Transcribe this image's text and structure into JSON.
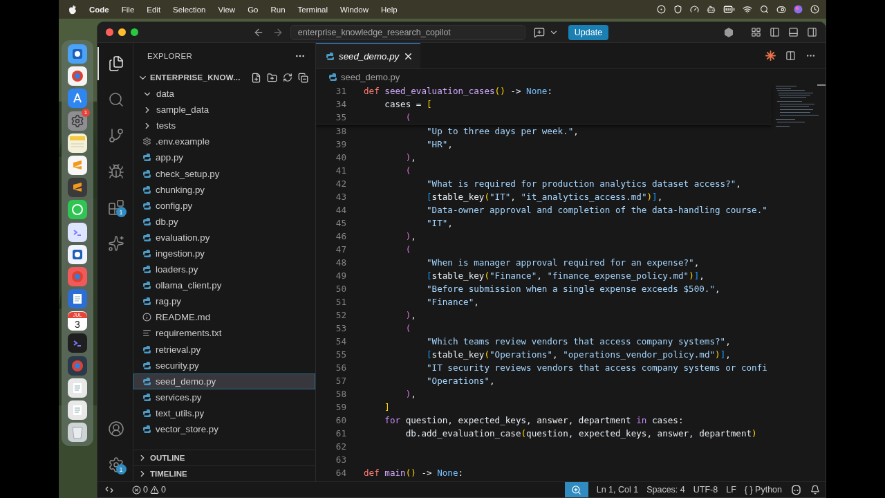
{
  "menu_bar": {
    "app": "Code",
    "items": [
      "File",
      "Edit",
      "Selection",
      "View",
      "Go",
      "Run",
      "Terminal",
      "Window",
      "Help"
    ]
  },
  "dock": {
    "items": [
      {
        "kind": "face",
        "color": "#4aa3f5"
      },
      {
        "kind": "ring",
        "color": "#f4f4f4"
      },
      {
        "kind": "letter",
        "color": "#2f86f0"
      },
      {
        "kind": "gear",
        "color": "#8e8e93",
        "badge": "1"
      },
      {
        "kind": "note",
        "color": "#f5f0d8"
      },
      {
        "kind": "ribbon",
        "color": "#f7f7f7"
      },
      {
        "kind": "ribbon",
        "color": "#3a3a3a"
      },
      {
        "kind": "bubble",
        "color": "#2fc553"
      },
      {
        "kind": "prompt",
        "color": "#dfe4ff"
      },
      {
        "kind": "face",
        "color": "#f2f4ff"
      },
      {
        "kind": "ring",
        "color": "#f05a5a"
      },
      {
        "kind": "doc",
        "color": "#2b6fd6"
      },
      {
        "kind": "calendar",
        "color": "#ffffff",
        "month": "JUL",
        "day": "3"
      },
      {
        "kind": "prompt",
        "color": "#1f1f1f"
      },
      {
        "kind": "ring",
        "color": "#2a3a4a"
      },
      {
        "kind": "doc",
        "color": "#e8e8e8"
      },
      {
        "kind": "doc",
        "color": "#e8e8e8"
      },
      {
        "kind": "bin",
        "color": "#cfd3d6"
      }
    ]
  },
  "window": {
    "title": "enterprise_knowledge_research_copilot",
    "update_button": "Update"
  },
  "activity_bar": {
    "items": [
      {
        "kind": "files",
        "selected": true
      },
      {
        "kind": "search",
        "selected": false
      },
      {
        "kind": "branch",
        "selected": false
      },
      {
        "kind": "debug",
        "selected": false
      },
      {
        "kind": "extensions",
        "selected": false,
        "badge": "1"
      },
      {
        "kind": "spark",
        "selected": false
      }
    ],
    "bottom": [
      {
        "kind": "account"
      },
      {
        "kind": "settings",
        "badge": "1"
      }
    ]
  },
  "sidebar": {
    "title": "EXPLORER",
    "root": {
      "label": "ENTERPRISE_KNOW...",
      "expanded": true
    },
    "items": [
      {
        "kind": "folder",
        "label": "data",
        "expanded": true,
        "selected": false
      },
      {
        "kind": "folder",
        "label": "sample_data",
        "expanded": false,
        "selected": false
      },
      {
        "kind": "folder",
        "label": "tests",
        "expanded": false,
        "selected": false
      },
      {
        "kind": "config",
        "label": ".env.example",
        "selected": false
      },
      {
        "kind": "python",
        "label": "app.py",
        "selected": false
      },
      {
        "kind": "python",
        "label": "check_setup.py",
        "selected": false
      },
      {
        "kind": "python",
        "label": "chunking.py",
        "selected": false
      },
      {
        "kind": "python",
        "label": "config.py",
        "selected": false
      },
      {
        "kind": "python",
        "label": "db.py",
        "selected": false
      },
      {
        "kind": "python",
        "label": "evaluation.py",
        "selected": false
      },
      {
        "kind": "python",
        "label": "ingestion.py",
        "selected": false
      },
      {
        "kind": "python",
        "label": "loaders.py",
        "selected": false
      },
      {
        "kind": "python",
        "label": "ollama_client.py",
        "selected": false
      },
      {
        "kind": "python",
        "label": "rag.py",
        "selected": false
      },
      {
        "kind": "info",
        "label": "README.md",
        "selected": false
      },
      {
        "kind": "text",
        "label": "requirements.txt",
        "selected": false
      },
      {
        "kind": "python",
        "label": "retrieval.py",
        "selected": false
      },
      {
        "kind": "python",
        "label": "security.py",
        "selected": false
      },
      {
        "kind": "python",
        "label": "seed_demo.py",
        "selected": true
      },
      {
        "kind": "python",
        "label": "services.py",
        "selected": false
      },
      {
        "kind": "python",
        "label": "text_utils.py",
        "selected": false
      },
      {
        "kind": "python",
        "label": "vector_store.py",
        "selected": false
      }
    ],
    "sections": [
      {
        "label": "OUTLINE",
        "expanded": false
      },
      {
        "label": "TIMELINE",
        "expanded": false
      }
    ]
  },
  "editor": {
    "tabs": [
      {
        "label": "seed_demo.py",
        "selected": true,
        "preview": true
      }
    ],
    "breadcrumb": "seed_demo.py",
    "sticky_lines": [
      {
        "number": "31",
        "tokens": [
          {
            "kind": "def",
            "text": "def "
          },
          {
            "kind": "func",
            "text": "seed_evaluation_cases"
          },
          {
            "kind": "b1",
            "text": "()"
          },
          {
            "kind": "text",
            "text": " -> "
          },
          {
            "kind": "const",
            "text": "None"
          },
          {
            "kind": "text",
            "text": ":"
          }
        ]
      },
      {
        "number": "34",
        "tokens": [
          {
            "kind": "text",
            "text": "    cases = "
          },
          {
            "kind": "b1",
            "text": "["
          }
        ]
      },
      {
        "number": "35",
        "tokens": [
          {
            "kind": "b2",
            "text": "        ("
          }
        ]
      }
    ],
    "lines": [
      {
        "number": "38",
        "tokens": [
          {
            "kind": "str",
            "text": "            \"Up to three days per week.\""
          },
          {
            "kind": "text",
            "text": ","
          }
        ]
      },
      {
        "number": "39",
        "tokens": [
          {
            "kind": "str",
            "text": "            \"HR\""
          },
          {
            "kind": "text",
            "text": ","
          }
        ]
      },
      {
        "number": "40",
        "tokens": [
          {
            "kind": "b2",
            "text": "        )"
          },
          {
            "kind": "text",
            "text": ","
          }
        ]
      },
      {
        "number": "41",
        "tokens": [
          {
            "kind": "b2",
            "text": "        ("
          }
        ]
      },
      {
        "number": "42",
        "tokens": [
          {
            "kind": "str",
            "text": "            \"What is required for production analytics dataset access?\""
          },
          {
            "kind": "text",
            "text": ","
          }
        ]
      },
      {
        "number": "43",
        "tokens": [
          {
            "kind": "b3",
            "text": "            ["
          },
          {
            "kind": "text",
            "text": "stable_key"
          },
          {
            "kind": "b1",
            "text": "("
          },
          {
            "kind": "str",
            "text": "\"IT\""
          },
          {
            "kind": "text",
            "text": ", "
          },
          {
            "kind": "str",
            "text": "\"it_analytics_access.md\""
          },
          {
            "kind": "b1",
            "text": ")"
          },
          {
            "kind": "b3",
            "text": "]"
          },
          {
            "kind": "text",
            "text": ","
          }
        ]
      },
      {
        "number": "44",
        "tokens": [
          {
            "kind": "str",
            "text": "            \"Data-owner approval and completion of the data-handling course.\""
          }
        ]
      },
      {
        "number": "45",
        "tokens": [
          {
            "kind": "str",
            "text": "            \"IT\""
          },
          {
            "kind": "text",
            "text": ","
          }
        ]
      },
      {
        "number": "46",
        "tokens": [
          {
            "kind": "b2",
            "text": "        )"
          },
          {
            "kind": "text",
            "text": ","
          }
        ]
      },
      {
        "number": "47",
        "tokens": [
          {
            "kind": "b2",
            "text": "        ("
          }
        ]
      },
      {
        "number": "48",
        "tokens": [
          {
            "kind": "str",
            "text": "            \"When is manager approval required for an expense?\""
          },
          {
            "kind": "text",
            "text": ","
          }
        ]
      },
      {
        "number": "49",
        "tokens": [
          {
            "kind": "b3",
            "text": "            ["
          },
          {
            "kind": "text",
            "text": "stable_key"
          },
          {
            "kind": "b1",
            "text": "("
          },
          {
            "kind": "str",
            "text": "\"Finance\""
          },
          {
            "kind": "text",
            "text": ", "
          },
          {
            "kind": "str",
            "text": "\"finance_expense_policy.md\""
          },
          {
            "kind": "b1",
            "text": ")"
          },
          {
            "kind": "b3",
            "text": "]"
          },
          {
            "kind": "text",
            "text": ","
          }
        ]
      },
      {
        "number": "50",
        "tokens": [
          {
            "kind": "str",
            "text": "            \"Before submission when a single expense exceeds $500.\""
          },
          {
            "kind": "text",
            "text": ","
          }
        ]
      },
      {
        "number": "51",
        "tokens": [
          {
            "kind": "str",
            "text": "            \"Finance\""
          },
          {
            "kind": "text",
            "text": ","
          }
        ]
      },
      {
        "number": "52",
        "tokens": [
          {
            "kind": "b2",
            "text": "        )"
          },
          {
            "kind": "text",
            "text": ","
          }
        ]
      },
      {
        "number": "53",
        "tokens": [
          {
            "kind": "b2",
            "text": "        ("
          }
        ]
      },
      {
        "number": "54",
        "tokens": [
          {
            "kind": "str",
            "text": "            \"Which teams review vendors that access company systems?\""
          },
          {
            "kind": "text",
            "text": ","
          }
        ]
      },
      {
        "number": "55",
        "tokens": [
          {
            "kind": "b3",
            "text": "            ["
          },
          {
            "kind": "text",
            "text": "stable_key"
          },
          {
            "kind": "b1",
            "text": "("
          },
          {
            "kind": "str",
            "text": "\"Operations\""
          },
          {
            "kind": "text",
            "text": ", "
          },
          {
            "kind": "str",
            "text": "\"operations_vendor_policy.md\""
          },
          {
            "kind": "b1",
            "text": ")"
          },
          {
            "kind": "b3",
            "text": "]"
          },
          {
            "kind": "text",
            "text": ","
          }
        ]
      },
      {
        "number": "56",
        "tokens": [
          {
            "kind": "str",
            "text": "            \"IT security reviews vendors that access company systems or confi"
          }
        ]
      },
      {
        "number": "57",
        "tokens": [
          {
            "kind": "str",
            "text": "            \"Operations\""
          },
          {
            "kind": "text",
            "text": ","
          }
        ]
      },
      {
        "number": "58",
        "tokens": [
          {
            "kind": "b2",
            "text": "        )"
          },
          {
            "kind": "text",
            "text": ","
          }
        ]
      },
      {
        "number": "59",
        "tokens": [
          {
            "kind": "b1",
            "text": "    ]"
          }
        ]
      },
      {
        "number": "60",
        "tokens": [
          {
            "kind": "control",
            "text": "    for"
          },
          {
            "kind": "text",
            "text": " question, expected_keys, answer, department "
          },
          {
            "kind": "control",
            "text": "in"
          },
          {
            "kind": "text",
            "text": " cases:"
          }
        ]
      },
      {
        "number": "61",
        "tokens": [
          {
            "kind": "text",
            "text": "        db.add_evaluation_case"
          },
          {
            "kind": "b1",
            "text": "("
          },
          {
            "kind": "text",
            "text": "question, expected_keys, answer, department"
          },
          {
            "kind": "b1",
            "text": ")"
          }
        ]
      },
      {
        "number": "62"
      },
      {
        "number": "63"
      },
      {
        "number": "64",
        "tokens": [
          {
            "kind": "def",
            "text": "def "
          },
          {
            "kind": "func",
            "text": "main"
          },
          {
            "kind": "b1",
            "text": "()"
          },
          {
            "kind": "text",
            "text": " -> "
          },
          {
            "kind": "const",
            "text": "None"
          },
          {
            "kind": "text",
            "text": ":"
          }
        ]
      }
    ]
  },
  "status_bar": {
    "errors": "0",
    "warnings": "0",
    "items": [
      "Ln 1, Col 1",
      "Spaces: 4",
      "UTF-8",
      "LF",
      "{ } Python"
    ]
  }
}
